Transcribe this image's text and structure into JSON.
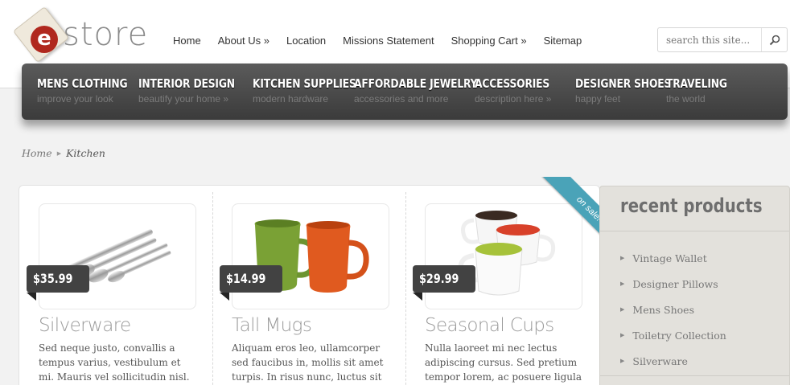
{
  "logo": {
    "letter": "e",
    "text": "store"
  },
  "topnav": [
    "Home",
    "About Us »",
    "Location",
    "Missions Statement",
    "Shopping Cart »",
    "Sitemap"
  ],
  "search": {
    "placeholder": "search this site..."
  },
  "categories": [
    {
      "title": "MENS CLOTHING",
      "subtitle": "improve your look"
    },
    {
      "title": "INTERIOR DESIGN",
      "subtitle": "beautify your home »"
    },
    {
      "title": "KITCHEN SUPPLIES",
      "subtitle": "modern hardware"
    },
    {
      "title": "AFFORDABLE JEWELRY",
      "subtitle": "accessories and more"
    },
    {
      "title": "ACCESSORIES",
      "subtitle": "description here »"
    },
    {
      "title": "DESIGNER SHOES",
      "subtitle": "happy feet"
    },
    {
      "title": "TRAVELING",
      "subtitle": "the world"
    }
  ],
  "breadcrumb": {
    "home": "Home",
    "current": "Kitchen"
  },
  "products": [
    {
      "price": "$35.99",
      "title": "Silverware",
      "description": "Sed neque justo, convallis a tempus varius, vestibulum et mi. Mauris vel sollicitudin nisl."
    },
    {
      "price": "$14.99",
      "title": "Tall Mugs",
      "description": "Aliquam eros leo, ullamcorper sed faucibus in, mollis sit amet turpis. In risus nunc, luctus sit"
    },
    {
      "price": "$29.99",
      "title": "Seasonal Cups",
      "description": "Nulla laoreet mi nec lectus adipiscing cursus. Sed pretium tempor lorem, ac posuere ligula"
    }
  ],
  "ribbon": "on sale!",
  "sidebar": {
    "title": "recent products",
    "items": [
      "Vintage Wallet",
      "Designer Pillows",
      "Mens Shoes",
      "Toiletry Collection",
      "Silverware"
    ]
  },
  "colors": {
    "accent_logo": "#b0281e",
    "navbar": "#444444",
    "ribbon": "#4aa3b8"
  }
}
